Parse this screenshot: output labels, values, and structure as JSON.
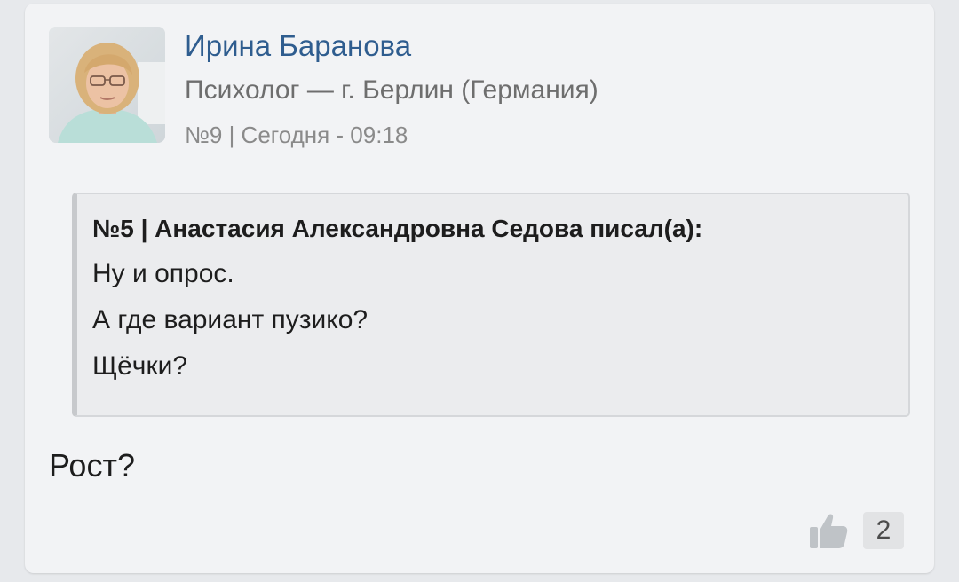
{
  "post": {
    "author_name": "Ирина Баранова",
    "author_role": "Психолог — г. Берлин (Германия)",
    "meta": "№9 | Сегодня - 09:18",
    "quote": {
      "header": "№5 | Анастасия Александровна Седова писал(а):",
      "lines": [
        "Ну и опрос.",
        "А где вариант пузико?",
        "Щёчки?"
      ]
    },
    "body": "Рост?",
    "likes": {
      "icon": "thumbs-up-icon",
      "count": "2"
    }
  },
  "colors": {
    "name": "#2f5d8f",
    "role": "#6e6e6e",
    "meta": "#8a8a8a",
    "card_bg": "#f2f3f5",
    "quote_bg": "#ebecee"
  }
}
